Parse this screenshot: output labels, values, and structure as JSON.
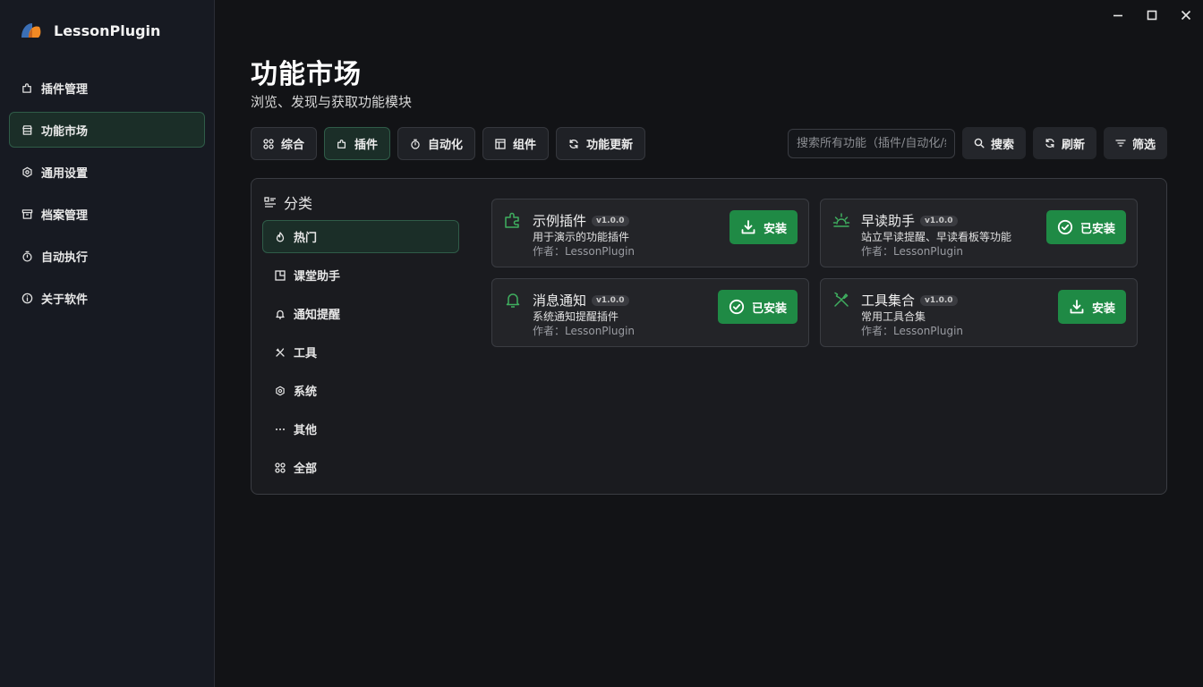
{
  "app": {
    "name": "LessonPlugin"
  },
  "sidebar": {
    "items": [
      {
        "label": "插件管理",
        "icon": "puzzle-icon"
      },
      {
        "label": "功能市场",
        "icon": "store-icon"
      },
      {
        "label": "通用设置",
        "icon": "gear-icon"
      },
      {
        "label": "档案管理",
        "icon": "archive-icon"
      },
      {
        "label": "自动执行",
        "icon": "stopwatch-icon"
      },
      {
        "label": "关于软件",
        "icon": "info-icon"
      }
    ]
  },
  "header": {
    "title": "功能市场",
    "subtitle": "浏览、发现与获取功能模块"
  },
  "tabs": [
    {
      "label": "综合"
    },
    {
      "label": "插件"
    },
    {
      "label": "自动化"
    },
    {
      "label": "组件"
    },
    {
      "label": "功能更新"
    }
  ],
  "toolbar": {
    "search_placeholder": "搜索所有功能（插件/自动化/组件）",
    "search_label": "搜索",
    "refresh_label": "刷新",
    "filter_label": "筛选"
  },
  "categories": {
    "title": "分类",
    "items": [
      {
        "label": "热门"
      },
      {
        "label": "课堂助手"
      },
      {
        "label": "通知提醒"
      },
      {
        "label": "工具"
      },
      {
        "label": "系统"
      },
      {
        "label": "其他"
      },
      {
        "label": "全部"
      }
    ]
  },
  "cards": [
    {
      "name": "示例插件",
      "version": "v1.0.0",
      "desc": "用于演示的功能插件",
      "author": "作者：LessonPlugin",
      "action": "安装"
    },
    {
      "name": "早读助手",
      "version": "v1.0.0",
      "desc": "站立早读提醒、早读看板等功能",
      "author": "作者：LessonPlugin",
      "action": "已安装"
    },
    {
      "name": "消息通知",
      "version": "v1.0.0",
      "desc": "系统通知提醒插件",
      "author": "作者：LessonPlugin",
      "action": "已安装"
    },
    {
      "name": "工具集合",
      "version": "v1.0.0",
      "desc": "常用工具合集",
      "author": "作者：LessonPlugin",
      "action": "安装"
    }
  ],
  "colors": {
    "accent": "#1f8a45",
    "active_bg": "#1b2e28",
    "active_border": "#2f5c48",
    "icon_green": "#3fae5f"
  }
}
